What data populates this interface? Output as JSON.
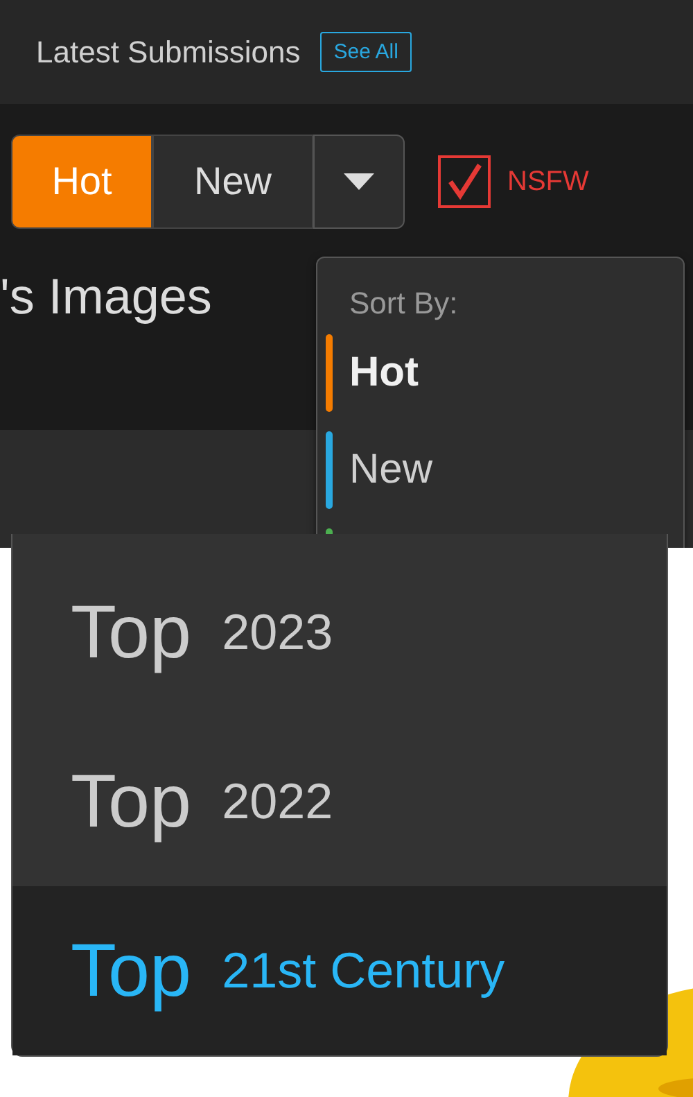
{
  "header": {
    "title": "Latest Submissions",
    "see_all": "See All"
  },
  "sort_tabs": [
    {
      "label": "Hot",
      "selected": true
    },
    {
      "label": "New",
      "selected": false
    }
  ],
  "nsfw": {
    "label": "NSFW",
    "checked": true
  },
  "section_title": "'s Images",
  "sort_menu": {
    "title": "Sort By:",
    "items": [
      {
        "label": "Hot",
        "color": "#f57c00",
        "selected": true
      },
      {
        "label": "New",
        "color": "#29a8e0",
        "selected": false
      },
      {
        "color": "#4caf50"
      }
    ]
  },
  "top_menu": {
    "items": [
      {
        "word": "Top",
        "period": "2023",
        "selected": false
      },
      {
        "word": "Top",
        "period": "2022",
        "selected": false
      },
      {
        "word": "Top",
        "period": "21st Century",
        "selected": true
      }
    ]
  }
}
